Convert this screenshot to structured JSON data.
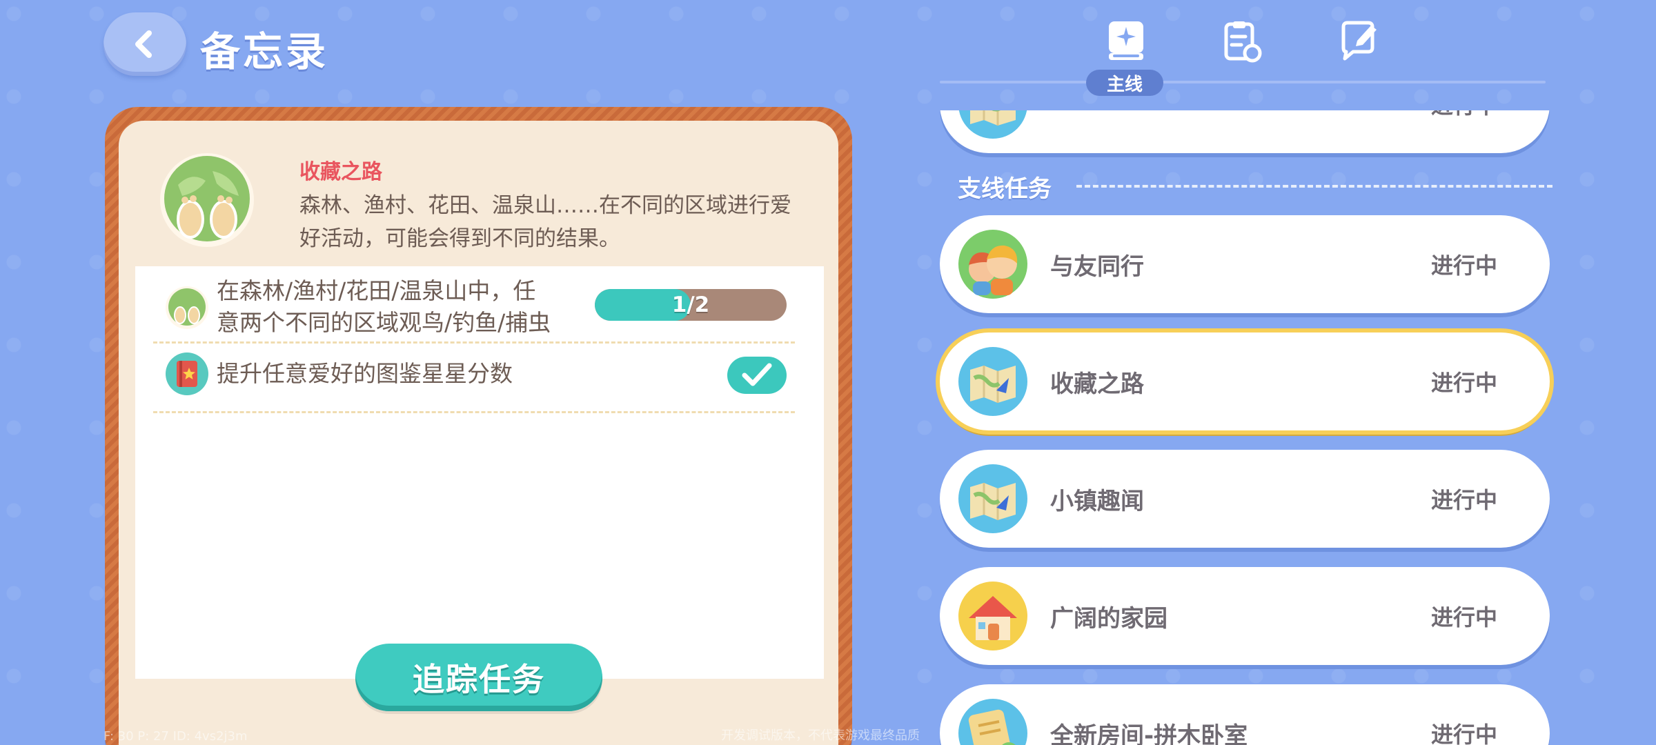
{
  "header": {
    "title": "备忘录"
  },
  "tabs": {
    "active_label": "主线",
    "items": [
      {
        "icon": "main-quest-book-icon"
      },
      {
        "icon": "clipboard-refresh-icon"
      },
      {
        "icon": "chat-edit-icon"
      }
    ]
  },
  "detail": {
    "name": "收藏之路",
    "description": "森林、渔村、花田、温泉山……在不同的区域进行爱好活动，可能会得到不同的结果。",
    "objectives": [
      {
        "text_line1": "在森林/渔村/花田/温泉山中，任",
        "text_line2": "意两个不同的区域观鸟/钓鱼/捕虫",
        "progress_text": "1/2",
        "progress": 0.5
      },
      {
        "text_line1": "提升任意爱好的图鉴星星分数",
        "completed": true
      }
    ],
    "track_button": "追踪任务"
  },
  "quest_list": {
    "top_status": "进行中",
    "section_title": "支线任务",
    "items": [
      {
        "name": "与友同行",
        "status": "进行中",
        "icon": "friends-icon"
      },
      {
        "name": "收藏之路",
        "status": "进行中",
        "icon": "map-icon"
      },
      {
        "name": "小镇趣闻",
        "status": "进行中",
        "icon": "map-icon"
      },
      {
        "name": "广阔的家园",
        "status": "进行中",
        "icon": "house-icon"
      },
      {
        "name": "全新房间-拼木卧室",
        "status": "进行中",
        "icon": "note-icon"
      }
    ]
  },
  "debug": {
    "left": "F: 30   P: 27   ID: 4vs2j3m",
    "right": "开发调试版本，不代表游戏最终品质"
  },
  "colors": {
    "background": "#86a8f1",
    "accent_teal": "#3cc8bd",
    "quest_name_red": "#e9555f",
    "selected_border": "#f7cf58",
    "card_frame": "#c96a3a"
  }
}
